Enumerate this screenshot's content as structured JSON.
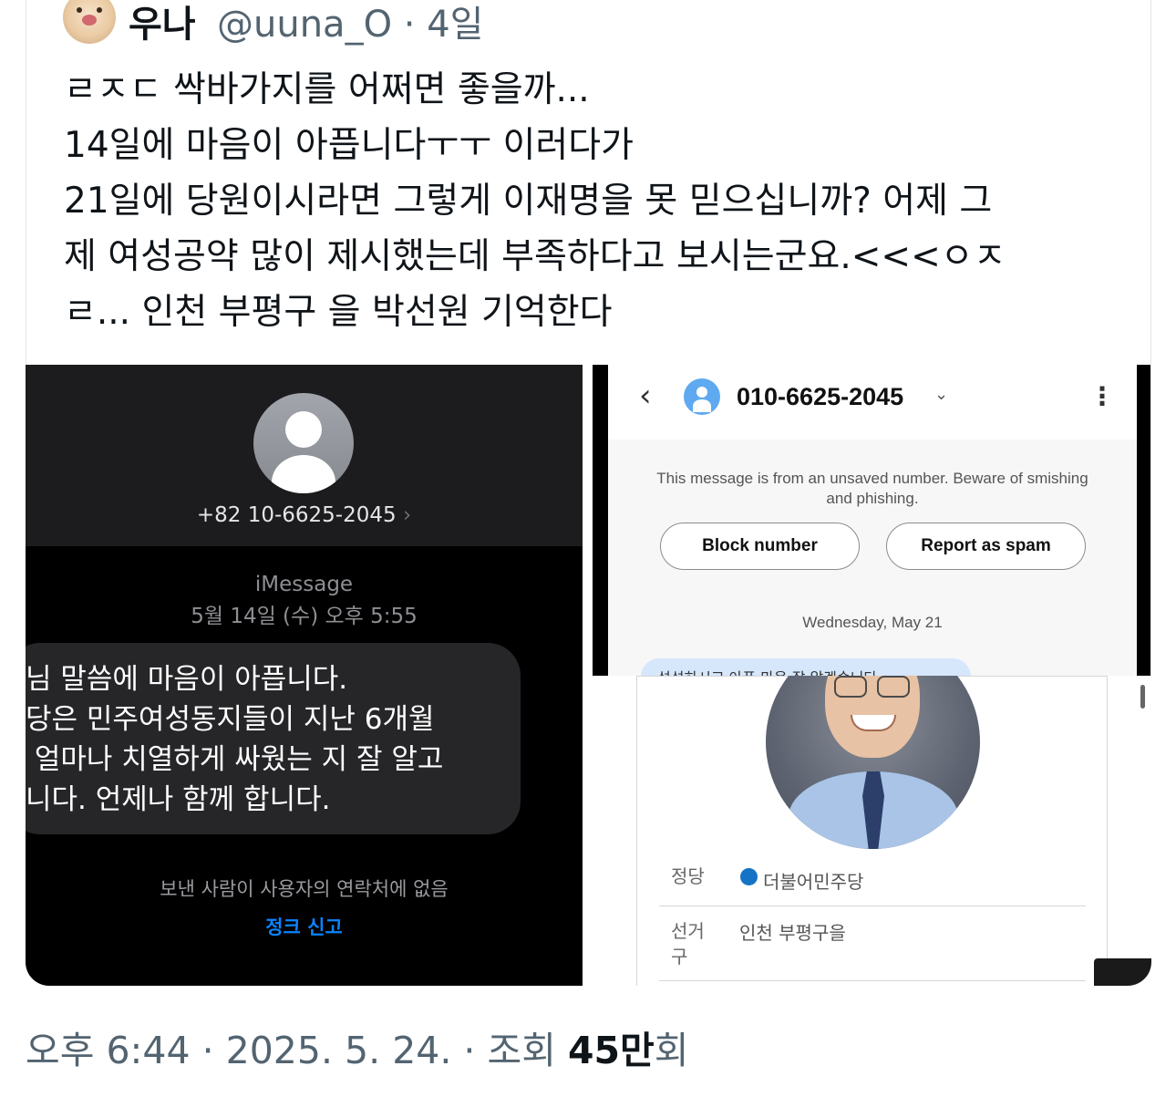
{
  "tweet": {
    "display_name": "우나",
    "handle_time": "@uuna_O · 4일",
    "lines": [
      "ㄹㅈㄷ 싹바가지를 어쩌면 좋을까...",
      "14일에 마음이 아픕니다ㅜㅜ 이러다가",
      "21일에 당원이시라면 그렇게 이재명을 못 믿으십니까? 어제 그",
      "제 여성공약 많이 제시했는데 부족하다고 보시는군요.<<<ㅇㅈ",
      "ㄹ... 인천 부평구 을 박선원 기억한다"
    ]
  },
  "imessage": {
    "sender_number": "+82 10-6625-2045",
    "chevron": "›",
    "service": "iMessage",
    "timestamp": "5월 14일 (수) 오후 5:55",
    "bubble_lines": [
      "님 말씀에 마음이 아픕니다.",
      "당은 민주여성동지들이 지난 6개월",
      " 얼마나 치열하게 싸웠는 지 잘 알고",
      "니다. 언제나 함께 합니다."
    ],
    "notice": "보낸 사람이 사용자의 연락처에 없음",
    "report_junk": "정크 신고"
  },
  "android": {
    "back": "‹",
    "number": "010-6625-2045",
    "caret": "⌄",
    "menu": "⋮",
    "warning": "This message is from an unsaved number. Beware of smishing and phishing.",
    "block_button": "Block number",
    "spam_button": "Report as spam",
    "date": "Wednesday, May 21",
    "partial_message": "섭섭하시고 아픈 마음 잘 알겠습니다"
  },
  "candidate": {
    "party_label": "정당",
    "party": "더불어민주당",
    "party_color": "#1573c6",
    "district_label": "선거구",
    "district": "인천 부평구을"
  },
  "footer": {
    "meta": "오후 6:44 · 2025. 5. 24. · 조회 ",
    "views": "45만",
    "views_suffix": "회"
  }
}
